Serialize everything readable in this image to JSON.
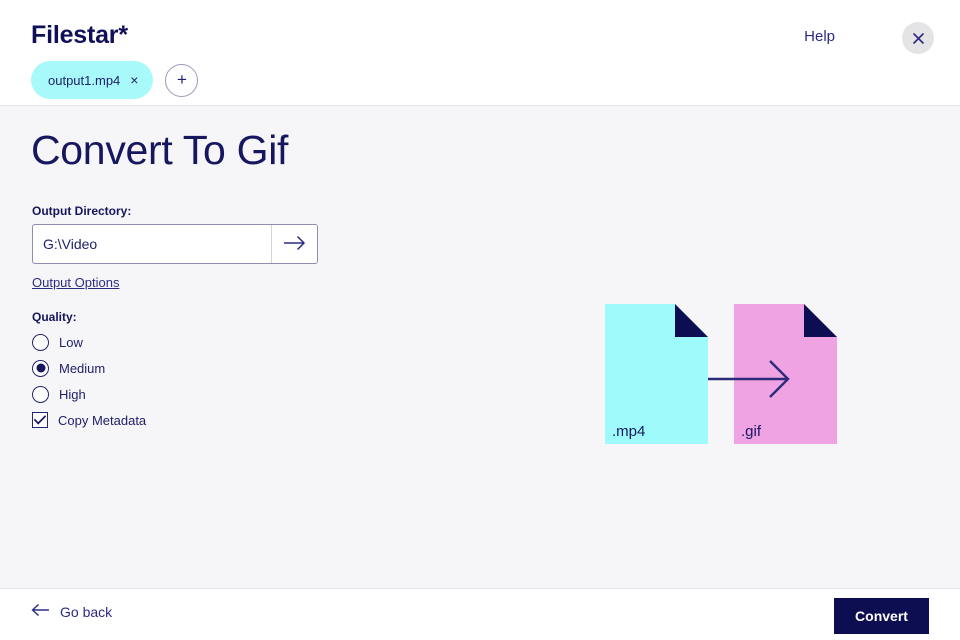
{
  "window": {
    "app_title": "Filestar*",
    "help_label": "Help",
    "close_icon": "close-icon"
  },
  "tabs": {
    "items": [
      {
        "label": "output1.mp4",
        "close_glyph": "×"
      }
    ],
    "add_glyph": "+"
  },
  "main": {
    "page_title": "Convert To Gif",
    "output_directory": {
      "label": "Output Directory:",
      "value": "G:\\Video",
      "placeholder": "Output directory",
      "go_icon": "arrow-right-icon"
    },
    "output_options_link": "Output Options",
    "quality": {
      "label": "Quality:",
      "options": [
        {
          "label": "Low",
          "selected": false
        },
        {
          "label": "Medium",
          "selected": true
        },
        {
          "label": "High",
          "selected": false
        }
      ]
    },
    "copy_metadata": {
      "label": "Copy Metadata",
      "checked": true
    },
    "illustration": {
      "source_label": ".mp4",
      "target_label": ".gif",
      "source_color": "#9ffbfb",
      "target_color": "#efa3e3",
      "fold_color": "#0d0d51",
      "arrow_color": "#2b2b7a",
      "arrow_icon": "arrow-right-icon"
    }
  },
  "footer": {
    "go_back_label": "Go back",
    "go_back_icon": "arrow-left-icon",
    "convert_label": "Convert"
  },
  "colors": {
    "navy": "#10105a",
    "link": "#2b2b84",
    "chip_bg": "#a8fafa",
    "body_bg": "#f6f6f8",
    "header_bg": "#ffffff",
    "button_bg": "#0d0d51",
    "close_circle_bg": "#e4e4e6"
  }
}
